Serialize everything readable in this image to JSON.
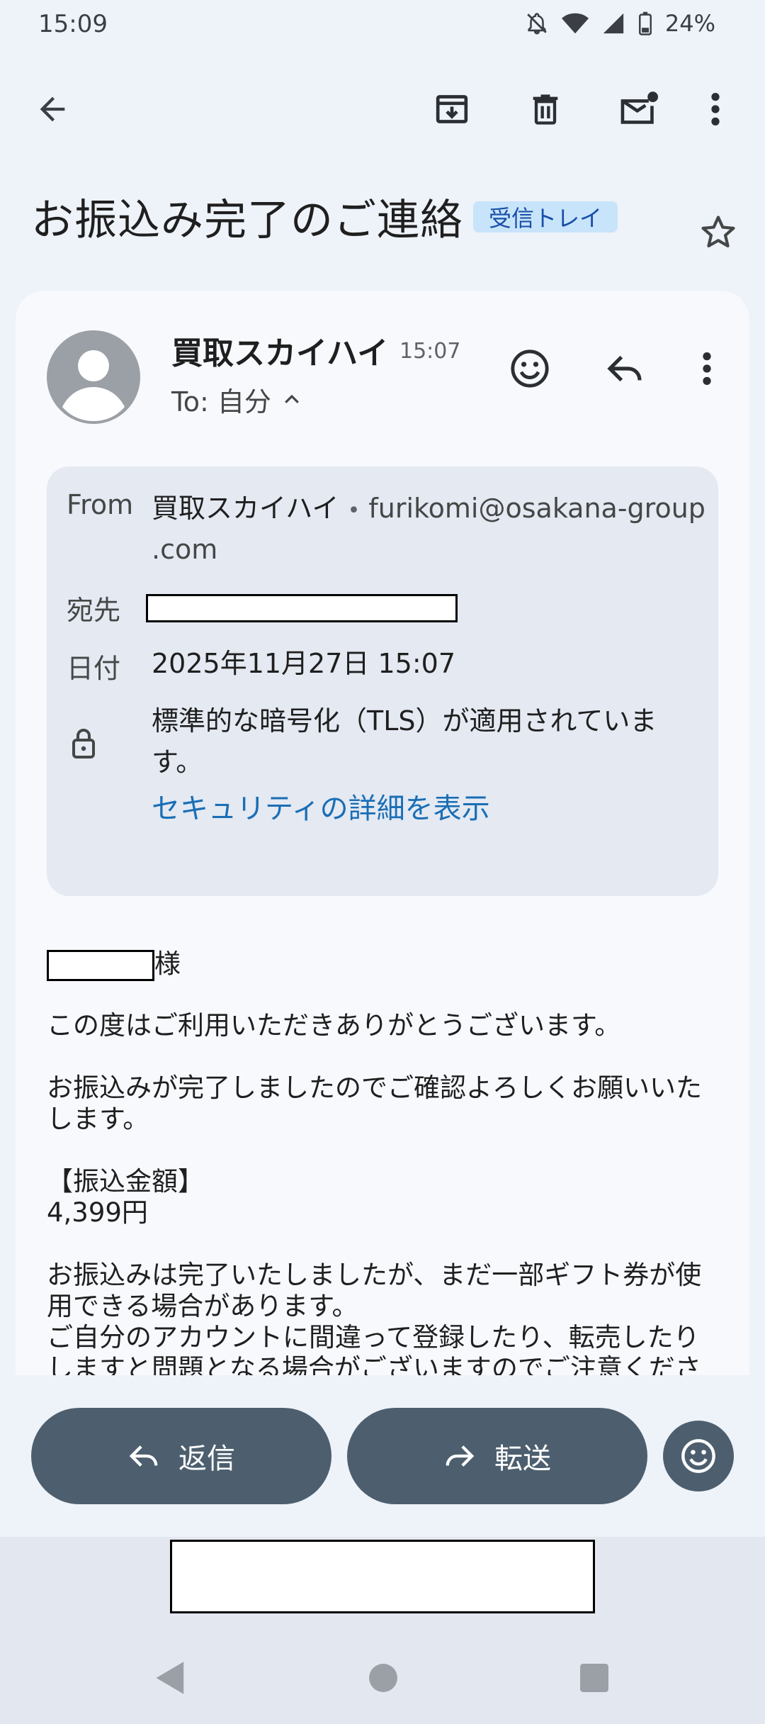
{
  "status_bar": {
    "time": "15:09",
    "battery": "24%"
  },
  "email": {
    "subject": "お振込み完了のご連絡",
    "label": "受信トレイ",
    "sender_name": "買取スカイハイ",
    "time": "15:07",
    "to_line": "To: 自分"
  },
  "details": {
    "from_label": "From",
    "from_name": "買取スカイハイ",
    "from_sep": "•",
    "from_email_1": "furikomi@osakana-group",
    "from_email_2": ".com",
    "to_label": "宛先",
    "date_label": "日付",
    "date_value": "2025年11月27日 15:07",
    "security_line1": "標準的な暗号化（TLS）が適用されていま",
    "security_line2": "す。",
    "security_link": "セキュリティの詳細を表示"
  },
  "body": {
    "salutation_suffix": "様",
    "p1": "この度はご利用いただきありがとうございます。",
    "p2_l1": "お振込みが完了しましたのでご確認よろしくお願いいた",
    "p2_l2": "します。",
    "amount_heading": "【振込金額】",
    "amount_value": "4,399円",
    "p3_l1": "お振込みは完了いたしましたが、まだ一部ギフト券が使",
    "p3_l2": "用できる場合があります。",
    "p3_l3": "ご自分のアカウントに間違って登録したり、転売したり",
    "p3_l4": "しますと問題となる場合がございますのでご注意くださ"
  },
  "actions": {
    "reply_label": "返信",
    "forward_label": "転送"
  },
  "icons": {
    "back": "arrow-left-icon",
    "archive": "archive-icon",
    "delete": "trash-icon",
    "unread": "mark-unread-icon",
    "more": "more-vert-icon",
    "star": "star-outline-icon",
    "emoji": "emoji-icon",
    "reply": "reply-icon",
    "lock": "lock-icon"
  },
  "colors": {
    "background": "#eef2f9",
    "card": "#f7f9fd",
    "details_bg": "#e4e9f2",
    "pill": "#4d5f6e",
    "link": "#1a6eb5",
    "chip": "#c8e4fb"
  }
}
